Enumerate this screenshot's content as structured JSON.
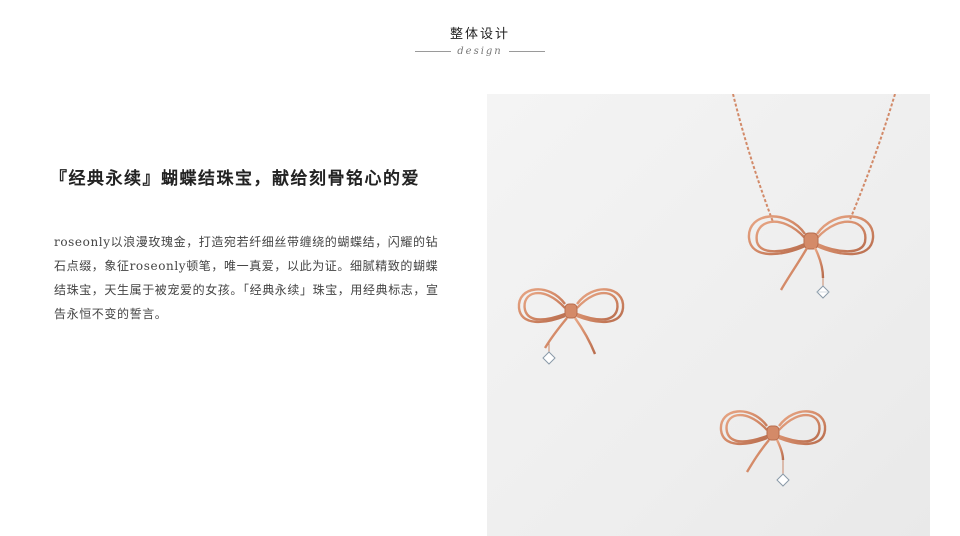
{
  "header": {
    "title": "整体设计",
    "subtitle": "design"
  },
  "headline": "『经典永续』蝴蝶结珠宝，献给刻骨铭心的爱",
  "description": "roseonly以浪漫玫瑰金，打造宛若纤细丝带缠绕的蝴蝶结，闪耀的钻石点缀，象征roseonly顿笔，唯一真爱，以此为证。细腻精致的蝴蝶结珠宝，天生属于被宠爱的女孩。「经典永续」珠宝，用经典标志，宣告永恒不变的誓言。",
  "colors": {
    "rose_gold": "#d9906f",
    "rose_gold_dark": "#b86d4e",
    "photo_bg": "#eeeeee"
  }
}
